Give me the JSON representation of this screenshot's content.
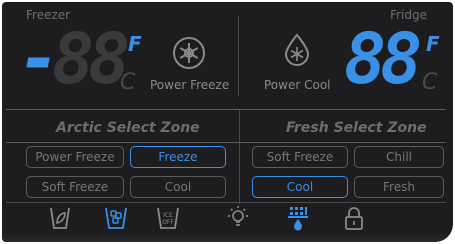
{
  "top": {
    "freezer_label": "Freezer",
    "fridge_label": "Fridge",
    "freezer_sign": "-",
    "freezer_digits": "88",
    "fridge_digits": "88",
    "unit_f": "F",
    "unit_c": "C",
    "power_freeze": "Power Freeze",
    "power_cool": "Power Cool"
  },
  "zones": {
    "arctic_title": "Arctic Select Zone",
    "fresh_title": "Fresh Select Zone",
    "arctic_options": [
      {
        "label": "Power Freeze",
        "active": false
      },
      {
        "label": "Freeze",
        "active": true
      },
      {
        "label": "Soft Freeze",
        "active": false
      },
      {
        "label": "Cool",
        "active": false
      }
    ],
    "fresh_options": [
      {
        "label": "Soft Freeze",
        "active": false
      },
      {
        "label": "Chill",
        "active": false
      },
      {
        "label": "Cool",
        "active": true
      },
      {
        "label": "Fresh",
        "active": false
      }
    ]
  },
  "bottom_icons": {
    "ice_off_text_top": "ICE",
    "ice_off_text_bottom": "OFF"
  },
  "colors": {
    "active_blue": "#3a8fe6",
    "panel_bg": "#1d1d1f",
    "inactive_text": "#77777a"
  }
}
